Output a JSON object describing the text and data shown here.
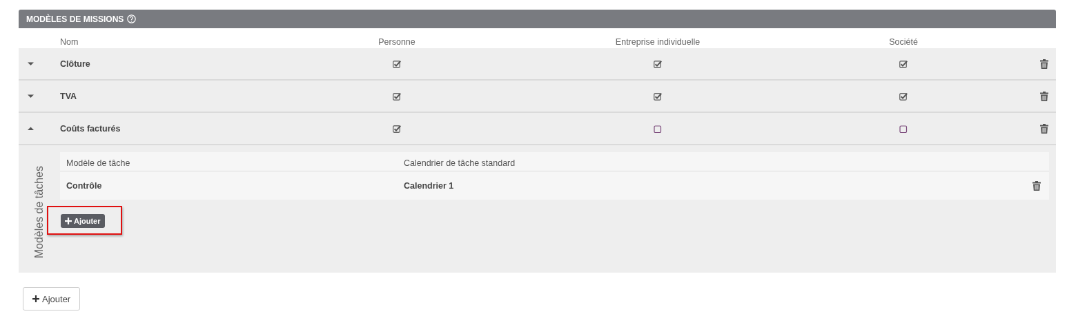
{
  "section": {
    "title": "MODÈLES DE MISSIONS"
  },
  "columns": [
    "Nom",
    "Personne",
    "Entreprise individuelle",
    "Société"
  ],
  "missions": [
    {
      "name": "Clôture",
      "expanded": false,
      "checks": [
        true,
        true,
        true
      ]
    },
    {
      "name": "TVA",
      "expanded": false,
      "checks": [
        true,
        true,
        true
      ]
    },
    {
      "name": "Coûts facturés",
      "expanded": true,
      "checks": [
        true,
        false,
        false
      ],
      "task_panel": {
        "label": "Modèles de tâches",
        "columns": [
          "Modèle de tâche",
          "Calendrier de tâche standard"
        ],
        "rows": [
          {
            "task": "Contrôle",
            "calendar": "Calendrier 1"
          }
        ],
        "add_button": {
          "label": "Ajouter",
          "highlighted": true
        }
      }
    }
  ],
  "add_button": {
    "label": "Ajouter"
  }
}
